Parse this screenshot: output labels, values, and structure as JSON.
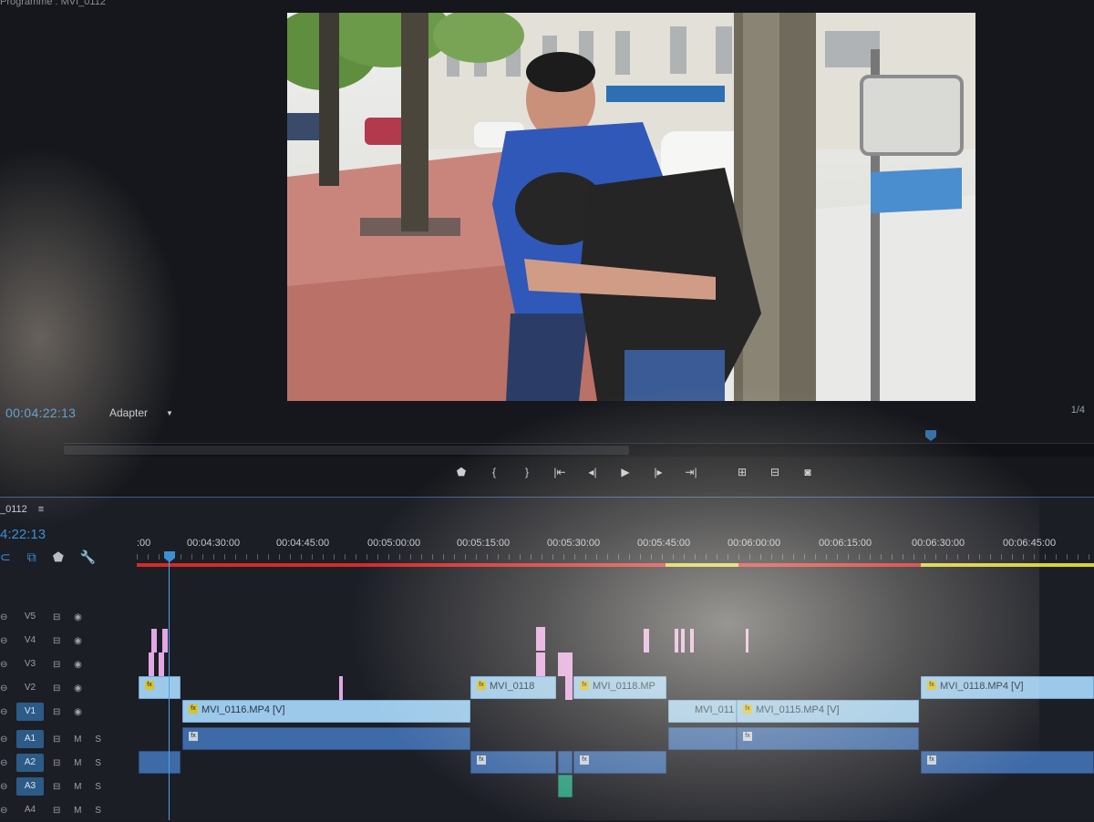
{
  "monitor": {
    "title": "Programme : MVI_0112",
    "timecode": "00:04:22:13",
    "fit": "Adapter",
    "resolution": "1/4",
    "transport": [
      {
        "name": "add-marker-icon",
        "glyph": "⬟"
      },
      {
        "name": "mark-in-icon",
        "glyph": "{"
      },
      {
        "name": "mark-out-icon",
        "glyph": "}"
      },
      {
        "name": "go-to-in-icon",
        "glyph": "|⇤"
      },
      {
        "name": "step-back-icon",
        "glyph": "◂|"
      },
      {
        "name": "play-icon",
        "glyph": "▶"
      },
      {
        "name": "step-forward-icon",
        "glyph": "|▸"
      },
      {
        "name": "go-to-out-icon",
        "glyph": "⇥|"
      },
      {
        "name": "lift-icon",
        "glyph": "⊞"
      },
      {
        "name": "extract-icon",
        "glyph": "⊟"
      },
      {
        "name": "export-frame-icon",
        "glyph": "◙"
      }
    ]
  },
  "timeline": {
    "sequence_tab": "_0112",
    "tab_menu": "≡",
    "timecode": "4:22:13",
    "tools": [
      {
        "name": "snap-icon",
        "glyph": "⊂"
      },
      {
        "name": "linked-selection-icon",
        "glyph": "⧉"
      },
      {
        "name": "add-marker-icon",
        "glyph": "⬟"
      },
      {
        "name": "settings-wrench-icon",
        "glyph": "🔧"
      }
    ],
    "ruler_labels": [
      ":00",
      "00:04:30:00",
      "00:04:45:00",
      "00:05:00:00",
      "00:05:15:00",
      "00:05:30:00",
      "00:05:45:00",
      "00:06:00:00",
      "00:06:15:00",
      "00:06:30:00",
      "00:06:45:00"
    ],
    "tracks": [
      {
        "id": "V5",
        "type": "video",
        "active": false,
        "controls": "⊟ ◉"
      },
      {
        "id": "V4",
        "type": "video",
        "active": false,
        "controls": "⊟ ◉"
      },
      {
        "id": "V3",
        "type": "video",
        "active": false,
        "controls": "⊟ ◉"
      },
      {
        "id": "V2",
        "type": "video",
        "active": false,
        "controls": "⊟ ◉"
      },
      {
        "id": "V1",
        "type": "video",
        "active": true,
        "controls": "⊟ ◉"
      },
      {
        "id": "A1",
        "type": "audio",
        "active": true,
        "controls": "⊟ M S"
      },
      {
        "id": "A2",
        "type": "audio",
        "active": true,
        "controls": "⊟ M S"
      },
      {
        "id": "A3",
        "type": "audio",
        "active": true,
        "controls": "⊟ M S"
      },
      {
        "id": "A4",
        "type": "audio",
        "active": false,
        "controls": "⊟ M S"
      }
    ],
    "clips": {
      "v2_a": "",
      "v2_mvi0118_a": "MVI_0118",
      "v2_mvi0118_b": "MVI_0118.MP",
      "v2_mvi0118_c": "MVI_0118.MP4 [V]",
      "v1_mvi0116": "MVI_0116.MP4 [V]",
      "v1_mvi011": "MVI_011",
      "v1_mvi0115": "MVI_0115.MP4 [V]",
      "fx": "fx"
    }
  },
  "colors": {
    "timecode": "#3d8fd1",
    "video_clip": "#9cc9ea",
    "audio_clip": "#3e6aa8",
    "render_red": "#d62a2a",
    "render_yellow": "#d9d23a",
    "marker_pink": "#e2a8e4"
  }
}
